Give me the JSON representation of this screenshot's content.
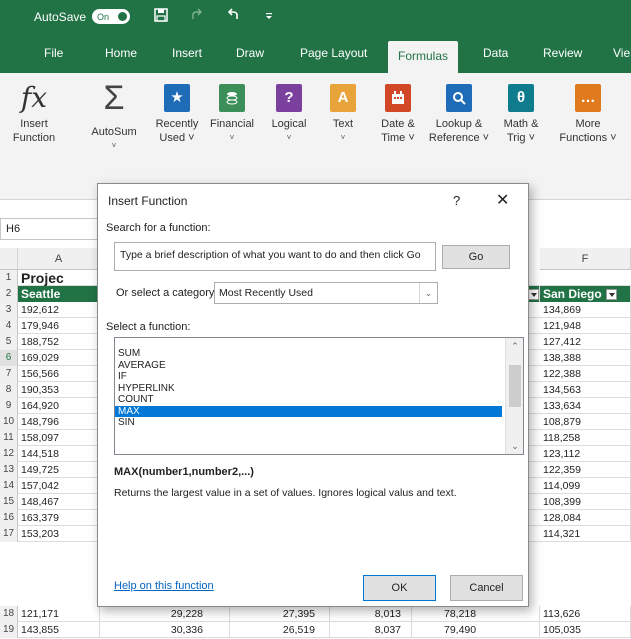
{
  "titlebar": {
    "autosave_label": "AutoSave",
    "toggle_label": "On"
  },
  "tabs": [
    "File",
    "Home",
    "Insert",
    "Draw",
    "Page Layout",
    "Formulas",
    "Data",
    "Review",
    "Vie"
  ],
  "active_tab": "Formulas",
  "ribbon": {
    "insert_function": [
      "Insert",
      "Function"
    ],
    "autosum": [
      "AutoSum",
      "˅"
    ],
    "recently_used": [
      "Recently",
      "Used ˅"
    ],
    "financial": [
      "Financial",
      "˅"
    ],
    "logical": [
      "Logical",
      "˅"
    ],
    "text": [
      "Text",
      "˅"
    ],
    "date_time": [
      "Date &",
      "Time ˅"
    ],
    "lookup_reference": [
      "Lookup &",
      "Reference ˅"
    ],
    "math_trig": [
      "Math &",
      "Trig ˅"
    ],
    "more_functions": [
      "More",
      "Functions ˅"
    ],
    "colors": {
      "blue": "#1e6bb8",
      "green": "#3d8f5a",
      "purple": "#7b3f9e",
      "yellow": "#e8a33a",
      "red": "#d24726",
      "teal": "#0e7c8c",
      "orange": "#e07a1f"
    }
  },
  "namebox": "H6",
  "grid": {
    "col_a": "A",
    "col_f": "F",
    "title": "Projec",
    "header_a": "Seattle",
    "header_f": "San Diego",
    "rows": [
      {
        "n": "3",
        "a": "192,612",
        "f": "134,869"
      },
      {
        "n": "4",
        "a": "179,946",
        "f": "121,948"
      },
      {
        "n": "5",
        "a": "188,752",
        "f": "127,412"
      },
      {
        "n": "6",
        "a": "169,029",
        "f": "138,388"
      },
      {
        "n": "7",
        "a": "156,566",
        "f": "122,388"
      },
      {
        "n": "8",
        "a": "190,353",
        "f": "134,563"
      },
      {
        "n": "9",
        "a": "164,920",
        "f": "133,634"
      },
      {
        "n": "10",
        "a": "148,796",
        "f": "108,879"
      },
      {
        "n": "11",
        "a": "158,097",
        "f": "118,258"
      },
      {
        "n": "12",
        "a": "144,518",
        "f": "123,112"
      },
      {
        "n": "13",
        "a": "149,725",
        "f": "122,359"
      },
      {
        "n": "14",
        "a": "157,042",
        "f": "114,099"
      },
      {
        "n": "15",
        "a": "148,467",
        "f": "108,399"
      },
      {
        "n": "16",
        "a": "163,379",
        "f": "128,084"
      },
      {
        "n": "17",
        "a": "153,203",
        "f": "114,321"
      }
    ],
    "row18": {
      "n": "18",
      "a": "121,171",
      "b": "29,228",
      "c": "27,395",
      "d": "8,013",
      "e": "78,218",
      "f": "113,626"
    },
    "row19": {
      "n": "19",
      "a": "143,855",
      "b": "30,336",
      "c": "26,519",
      "d": "8,037",
      "e": "79,490",
      "f": "105,035"
    }
  },
  "dialog": {
    "title": "Insert Function",
    "help": "?",
    "close": "✕",
    "search_label": "Search for a function:",
    "search_placeholder": "Type a brief description of what you want to do and then click Go",
    "go_label": "Go",
    "category_label": "Or select a category:",
    "category_value": "Most Recently Used",
    "select_label": "Select a function:",
    "functions": [
      "SUM",
      "AVERAGE",
      "IF",
      "HYPERLINK",
      "COUNT",
      "MAX",
      "SIN"
    ],
    "selected_function": "MAX",
    "syntax": "MAX(number1,number2,...)",
    "description": "Returns the largest value in a set of values. Ignores logical valus and text.",
    "help_link": "Help on this function",
    "ok_label": "OK",
    "cancel_label": "Cancel"
  }
}
